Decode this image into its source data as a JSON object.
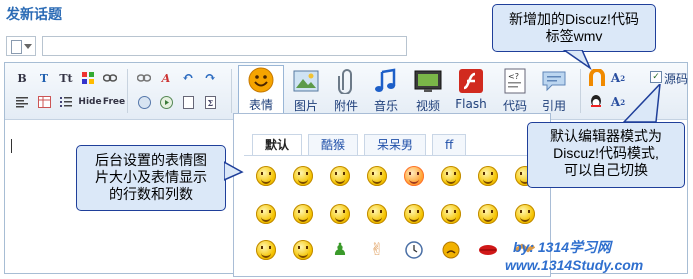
{
  "page": {
    "title": "发新话题"
  },
  "toolbar": {
    "buttons": [
      {
        "label": "表情",
        "icon": "smiley-icon"
      },
      {
        "label": "图片",
        "icon": "picture-icon"
      },
      {
        "label": "附件",
        "icon": "paperclip-icon"
      },
      {
        "label": "音乐",
        "icon": "music-note-icon"
      },
      {
        "label": "视频",
        "icon": "video-icon"
      },
      {
        "label": "Flash",
        "icon": "flash-icon"
      },
      {
        "label": "代码",
        "icon": "code-icon"
      },
      {
        "label": "引用",
        "icon": "quote-icon"
      }
    ],
    "small_tools": [
      "B",
      "Tt",
      "Hide",
      "Free"
    ],
    "source_mode_label": "源码"
  },
  "smiley_panel": {
    "tabs": [
      "默认",
      "酷猴",
      "呆呆男",
      "ff"
    ]
  },
  "callouts": {
    "top_right": [
      "新增加的Discuz!代码",
      "标签wmv"
    ],
    "left": [
      "后台设置的表情图",
      "片大小及表情显示",
      "的行数和列数"
    ],
    "right": [
      "默认编辑器模式为",
      "Discuz!代码模式,",
      "可以自己切换"
    ]
  },
  "watermark": {
    "line1": "by: 1314学习网",
    "line2": "www.1314Study.com"
  },
  "colors": {
    "title": "#2b6bb5",
    "callout_bg": "#dbe8f8",
    "callout_border": "#1f3f9a"
  }
}
